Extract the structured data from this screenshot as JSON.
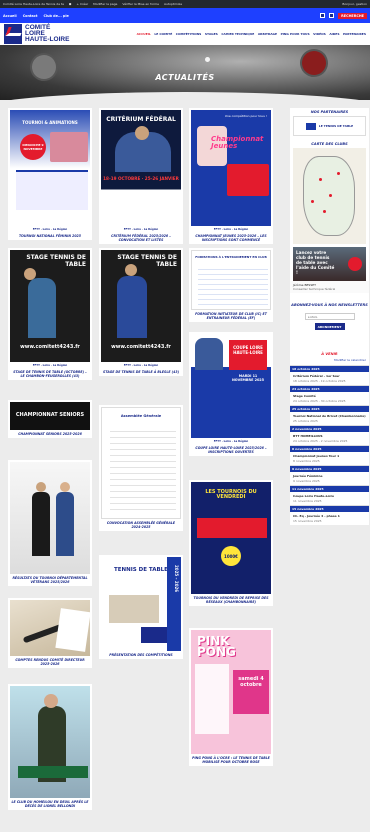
{
  "admin_bar": {
    "items": [
      "Comité Loire Haute-Loire de Tennis de ta",
      "0",
      "0",
      "+ Créer",
      "Modifier la page",
      "Vérifier la Mise en forme",
      "Autoptimize"
    ],
    "greeting": "Bonjour, gestion"
  },
  "top_bar": {
    "left": [
      "Accueil",
      "Contact",
      "Club de... ple"
    ],
    "right": [
      "RECHERCHE"
    ]
  },
  "logo": {
    "line1": "COMITÉ",
    "line2": "LOIRE",
    "line3": "HAUTE-LOIRE",
    "sub1": "TENNIS",
    "sub2": "TABLE"
  },
  "nav": {
    "items": [
      "ACCUEIL",
      "LE COMITÉ",
      "COMPÉTITIONS",
      "STAGES",
      "CAHIER TECHNIQUE",
      "ARBITRAGE",
      "PING POUR TOUS",
      "VIDÉOS",
      "AIDES",
      "PARTENAIRES"
    ]
  },
  "hero": {
    "title": "ACTUALITÉS"
  },
  "posts": [
    {
      "caption": "TOURNOI NATIONAL FÉMININ 2025",
      "img_title": "TOURNOI & ANIMATIONS",
      "img_sub": "DIMANCHE 9 NOVEMBRE"
    },
    {
      "caption": "CRITÉRIUM FÉDÉRAL 2025/2026 – CONVOCATION ET LISTES",
      "img_title": "CRITÉRIUM FÉDÉRAL",
      "img_sub": "18-19 OCTOBRE · 25-26 JANVIER"
    },
    {
      "caption": "CHAMPIONNAT JEUNES 2025-2026 – LES INSCRIPTIONS SONT COMMENCÉ",
      "img_title": "Championnat Jeunes",
      "img_sub": "Une compétition pour tous !"
    },
    {
      "caption": "STAGE DE TENNIS DE TABLE (OCTOBRE) – LE CHAMBON-FEUGEROLLES (43)",
      "img_title": "STAGE TENNIS DE TABLE",
      "img_sub": "www.comitett4243.fr"
    },
    {
      "caption": "STAGE DE TENNIS DE TABLE À BLESLE (43)",
      "img_title": "STAGE TENNIS DE TABLE",
      "img_sub": "www.comitett4243.fr"
    },
    {
      "caption": "FORMATION INITIATEUR DE CLUB (IC) ET ENTRAINEUR FÉDÉRAL (EF)",
      "img_title": "FORMATIONS À L'ENTRAINEMENT EN CLUB",
      "img_sub": ""
    },
    {
      "caption": "CHAMPIONNAT SENIORS 2025-2026",
      "img_title": "CHAMPIONNAT SENIORS",
      "img_sub": ""
    },
    {
      "caption": "CONVOCATION ASSEMBLÉE GÉNÉRALE 2024-2025",
      "img_title": "Assemblée Générale",
      "img_sub": ""
    },
    {
      "caption": "COUPE LOIRE HAUTE-LOIRE 2025/2026 – INSCRIPTIONS OUVERTES",
      "img_title": "COUPE LOIRE HAUTE-LOIRE",
      "img_sub": "MARDI 11 NOVEMBRE 2025"
    },
    {
      "caption": "RÉSULTATS DU TOURNOI DÉPARTEMENTAL VÉTÉRANS 2025/2026",
      "img_title": "",
      "img_sub": ""
    },
    {
      "caption": "PRÉSENTATION DES COMPÉTITIONS",
      "img_title": "TENNIS DE TABLE",
      "img_sub": "2025 – 2026"
    },
    {
      "caption": "TOURNOIS DU VENDREDI DE REPRISE DES RÉSEAUX (CHAMBONNAIRE)",
      "img_title": "LES TOURNOIS DU VENDREDI",
      "img_sub": "1000€"
    },
    {
      "caption": "COMPTES RENDUS COMITÉ DIRECTEUR 2025-2026",
      "img_title": "",
      "img_sub": ""
    },
    {
      "caption": "PING PONG À L'OCRE : LE TENNIS DE TABLE MOBILISÉ POUR OCTOBRE ROSE",
      "img_title": "PINK PONG",
      "img_sub": "samedi 4 octobre"
    },
    {
      "caption": "LE CLUB DU HOMEILOU EN DEUIL APRÈS LE DÉCÈS DE LIONEL BELLONDI",
      "img_title": "",
      "img_sub": ""
    }
  ],
  "sidebar": {
    "partners_title": "NOS PARTENAIRES",
    "partner_name": "LE TENNIS DE TABLE",
    "map_title": "CARTE DES CLUBS",
    "map_caption": "Lancez votre club de tennis de table avec l'aide du Comité !",
    "contact_name": "Jérôme BESSET",
    "contact_role": "Conseiller technique fédéral",
    "newsletter_title": "ABONNEZ-VOUS À NOS NEWSLETTERS",
    "email_placeholder": "E-MAIL",
    "subscribe_label": "ABONNEMENT",
    "agenda_title": "À VENIR",
    "agenda_link": "Modifier le calendrier",
    "events": [
      {
        "date": "18 octobre 2025",
        "name": "Critérium Fédéral - 1er tour",
        "sub": "18 octobre 2025 - 19 octobre 2025"
      },
      {
        "date": "24 octobre 2025",
        "name": "Stage Comité",
        "sub": "24 octobre 2025 - 30 octobre 2025"
      },
      {
        "date": "25 octobre 2025",
        "name": "Tournoi National de Brivet (Chambonnaire)",
        "sub": "25 octobre 2025"
      },
      {
        "date": "2 novembre 2025",
        "name": "BTT HOMEILLOUS",
        "sub": "24 octobre 2025 - 2 novembre 2025"
      },
      {
        "date": "8 novembre 2025",
        "name": "Championnat Jeunes Tour 1",
        "sub": "8 novembre 2025"
      },
      {
        "date": "9 novembre 2025",
        "name": "Journée Féminine",
        "sub": "9 novembre 2025"
      },
      {
        "date": "11 novembre 2025",
        "name": "Coupe Loire Haute-Loire",
        "sub": "11 novembre 2025"
      },
      {
        "date": "15 novembre 2025",
        "name": "Ch. Eq - Journée 4 - phase 1",
        "sub": "15 novembre 2025"
      }
    ]
  }
}
